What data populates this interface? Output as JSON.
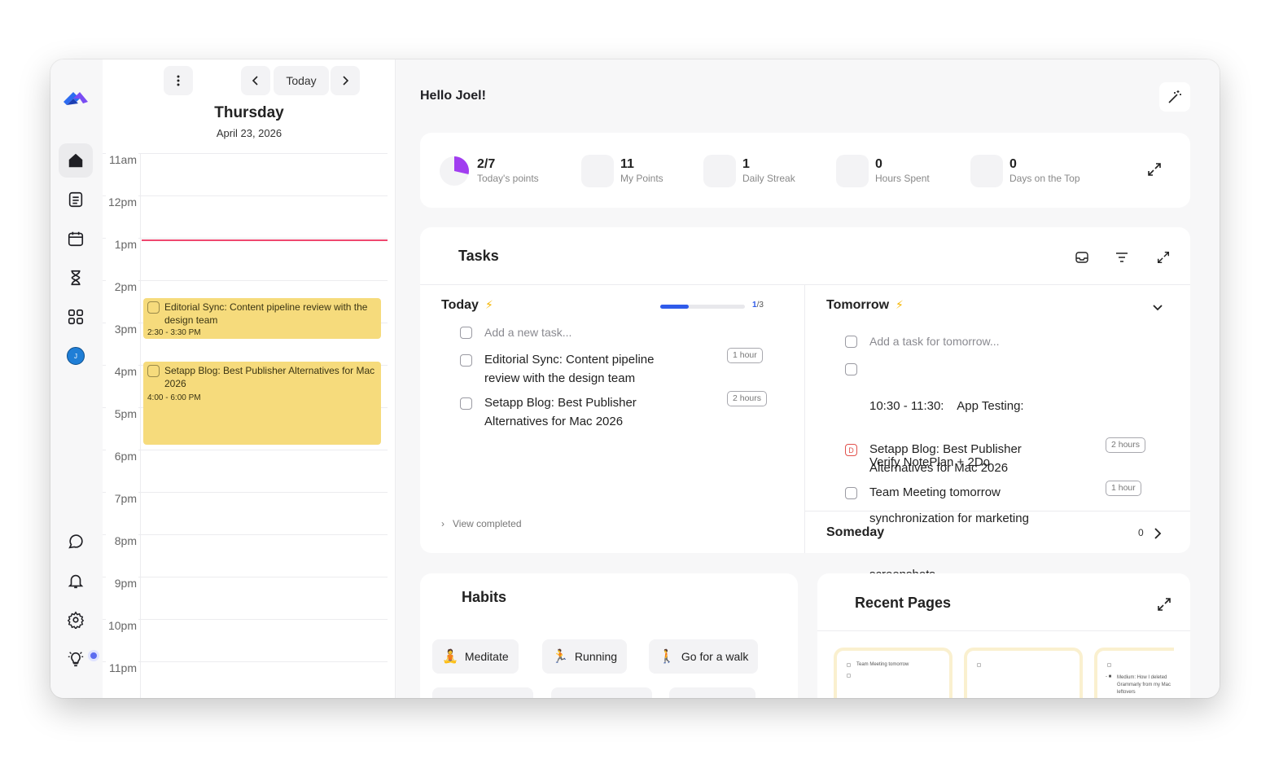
{
  "nav": {
    "items": [
      {
        "name": "home",
        "icon": "home-icon"
      },
      {
        "name": "notes",
        "icon": "notes-icon"
      },
      {
        "name": "calendar",
        "icon": "calendar-icon"
      },
      {
        "name": "timer",
        "icon": "hourglass-icon"
      },
      {
        "name": "apps",
        "icon": "grid-icon"
      },
      {
        "name": "profile",
        "icon": "avatar-icon",
        "initial": "J"
      }
    ],
    "bottom": [
      "chat-icon",
      "bell-icon",
      "gear-icon",
      "lightbulb-icon"
    ]
  },
  "calendar": {
    "today_label": "Today",
    "day_name": "Thursday",
    "date": "April 23, 2026",
    "hours": [
      "11am",
      "12pm",
      "1pm",
      "2pm",
      "3pm",
      "4pm",
      "5pm",
      "6pm",
      "7pm",
      "8pm",
      "9pm",
      "10pm",
      "11pm"
    ],
    "events": [
      {
        "title": "Editorial Sync: Content pipeline review with the design team",
        "time": "2:30 - 3:30 PM"
      },
      {
        "title": "Setapp Blog: Best Publisher Alternatives for Mac 2026",
        "time": "4:00 - 6:00 PM"
      }
    ]
  },
  "main": {
    "greeting": "Hello Joel!",
    "stats": [
      {
        "value": "2/7",
        "caption": "Today's points",
        "progress": 0.2857
      },
      {
        "value": "11",
        "caption": "My Points"
      },
      {
        "value": "1",
        "caption": "Daily Streak"
      },
      {
        "value": "0",
        "caption": "Hours Spent"
      },
      {
        "value": "0",
        "caption": "Days on the Top"
      }
    ],
    "tasks": {
      "title": "Tasks",
      "today": {
        "label": "Today",
        "progress_done": "1",
        "progress_total": "/3",
        "progress_fraction": 0.3333,
        "placeholder": "Add a new task...",
        "items": [
          {
            "line1": "Editorial Sync: Content pipeline",
            "line2": "review with the design team",
            "tag": "1 hour"
          },
          {
            "line1": "Setapp Blog: Best Publisher",
            "line2": "Alternatives for Mac 2026",
            "tag": "2 hours"
          }
        ],
        "view_completed": "View completed"
      },
      "tomorrow": {
        "label": "Tomorrow",
        "placeholder": "Add a task for tomorrow...",
        "items": [
          {
            "lines": [
              "10:30 - 11:30:    App Testing:",
              "Verify NotePlan + 2Do",
              "synchronization for marketing",
              "screenshots."
            ]
          },
          {
            "lines": [
              "Setapp Blog: Best Publisher",
              "Alternatives for Mac 2026"
            ],
            "tag": "2 hours",
            "deadline_badge": "D"
          },
          {
            "lines": [
              "Team Meeting tomorrow"
            ],
            "tag": "1 hour"
          }
        ]
      },
      "someday": {
        "label": "Someday",
        "count": "0"
      }
    },
    "habits": {
      "title": "Habits",
      "items": [
        {
          "emoji": "🧘",
          "label": "Meditate"
        },
        {
          "emoji": "🏃",
          "label": "Running"
        },
        {
          "emoji": "🚶",
          "label": "Go for a walk"
        }
      ]
    },
    "recent_pages": {
      "title": "Recent Pages",
      "thumbs": [
        {
          "text": "Team Meeting tomorrow"
        },
        {
          "text": ""
        },
        {
          "text": "Medium: How I deleted Grammarly from my Mac leftovers"
        }
      ]
    }
  },
  "colors": {
    "accent": "#2f5bea",
    "event": "#f6db7c",
    "now_line": "#ef476f",
    "streak": "#f6b500",
    "points_ring": "#a13df0"
  }
}
